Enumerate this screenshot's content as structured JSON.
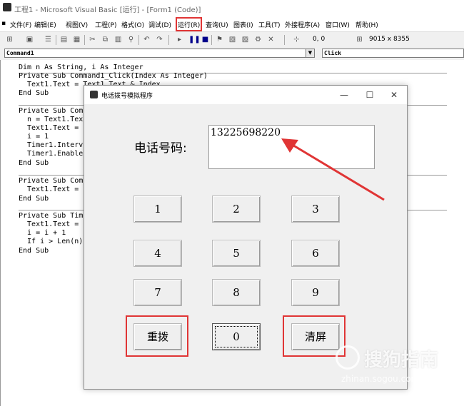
{
  "ide": {
    "title": "工程1 - Microsoft Visual Basic [运行] - [Form1 (Code)]",
    "menu": [
      "文件(F)",
      "编辑(E)",
      "视图(V)",
      "工程(P)",
      "格式(O)",
      "调试(D)",
      "运行(R)",
      "查询(U)",
      "图表(I)",
      "工具(T)",
      "外接程序(A)",
      "窗口(W)",
      "帮助(H)"
    ],
    "toolbar": {
      "position": "0, 0",
      "size": "9015 x 8355"
    },
    "object_combo": "Command1",
    "proc_combo": "Click"
  },
  "code": [
    "Dim n As String, i As Integer",
    "Private Sub Command1_Click(Index As Integer)",
    "  Text1.Text = Text1.Text & Index",
    "End Sub",
    "Private Sub Com",
    "  n = Text1.Tex",
    "  Text1.Text =",
    "  i = 1",
    "  Timer1.Interv",
    "  Timer1.Enable",
    "End Sub",
    "Private Sub Com",
    "  Text1.Text =",
    "End Sub",
    "Private Sub Tim",
    "  Text1.Text =",
    "  i = i + 1",
    "  If i > Len(n)",
    "End Sub"
  ],
  "form": {
    "title": "电话拨号模拟程序",
    "phone_label": "电话号码:",
    "phone_value": "13225698220",
    "keys": [
      "1",
      "2",
      "3",
      "4",
      "5",
      "6",
      "7",
      "8",
      "9",
      "0"
    ],
    "redial": "重拨",
    "clear": "清屏"
  },
  "watermark": {
    "text": "搜狗指南",
    "url": "zhinan.sogou.com"
  },
  "colors": {
    "annotation": "#e03535",
    "keyword": "#00008b"
  }
}
